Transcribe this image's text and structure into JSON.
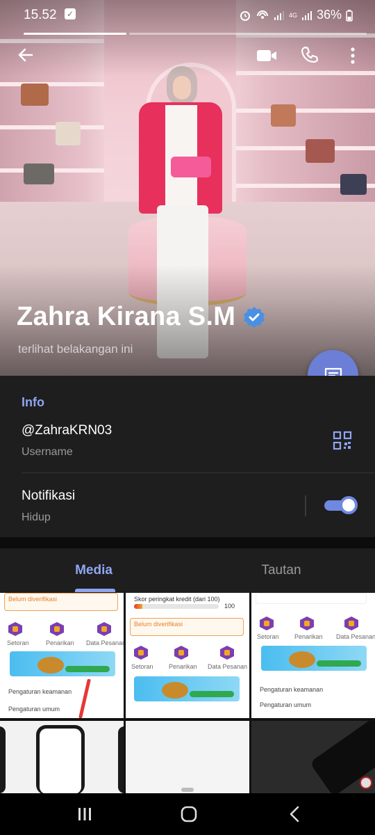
{
  "status_bar": {
    "time": "15.52",
    "network": "4G",
    "battery": "36%"
  },
  "story_progress": {
    "viewed_fraction": 0.3
  },
  "profile": {
    "name": "Zahra Kirana S.M",
    "verified": true,
    "last_seen": "terlihat belakangan ini"
  },
  "info": {
    "section_title": "Info",
    "username_value": "@ZahraKRN03",
    "username_label": "Username",
    "notifications_title": "Notifikasi",
    "notifications_state": "Hidup",
    "notifications_enabled": true
  },
  "tabs": {
    "media": "Media",
    "links": "Tautan"
  },
  "media_grid": {
    "thumb1": {
      "warning": "Belum diverifikasi",
      "shortcut_1": "Setoran",
      "shortcut_2": "Penarikan",
      "shortcut_3": "Data Pesanan",
      "setting_1": "Pengaturan keamanan",
      "setting_2": "Pengaturan umum"
    },
    "thumb2": {
      "score_label": "Skor peringkat kredit (dari 100)",
      "score_value": "100",
      "score_fill": 0.1,
      "warning": "Belum diverifikasi",
      "shortcut_1": "Setoran",
      "shortcut_2": "Penarikan",
      "shortcut_3": "Data Pesanan"
    },
    "thumb3": {
      "shortcut_1": "Setoran",
      "shortcut_2": "Penarikan",
      "shortcut_3": "Data Pesanan",
      "setting_1": "Pengaturan keamanan",
      "setting_2": "Pengaturan umum"
    }
  },
  "colors": {
    "accent": "#8fa5f2",
    "fab": "#6b7fd6",
    "toggle_on": "#6f88e0",
    "verified_badge": "#4a90e2",
    "background": "#1e1e1e"
  },
  "icons": {
    "back": "arrow-left-icon",
    "video": "video-camera-icon",
    "call": "phone-icon",
    "more": "more-vertical-icon",
    "fab": "message-icon",
    "qr": "qr-code-icon",
    "verified": "verified-badge-icon"
  }
}
